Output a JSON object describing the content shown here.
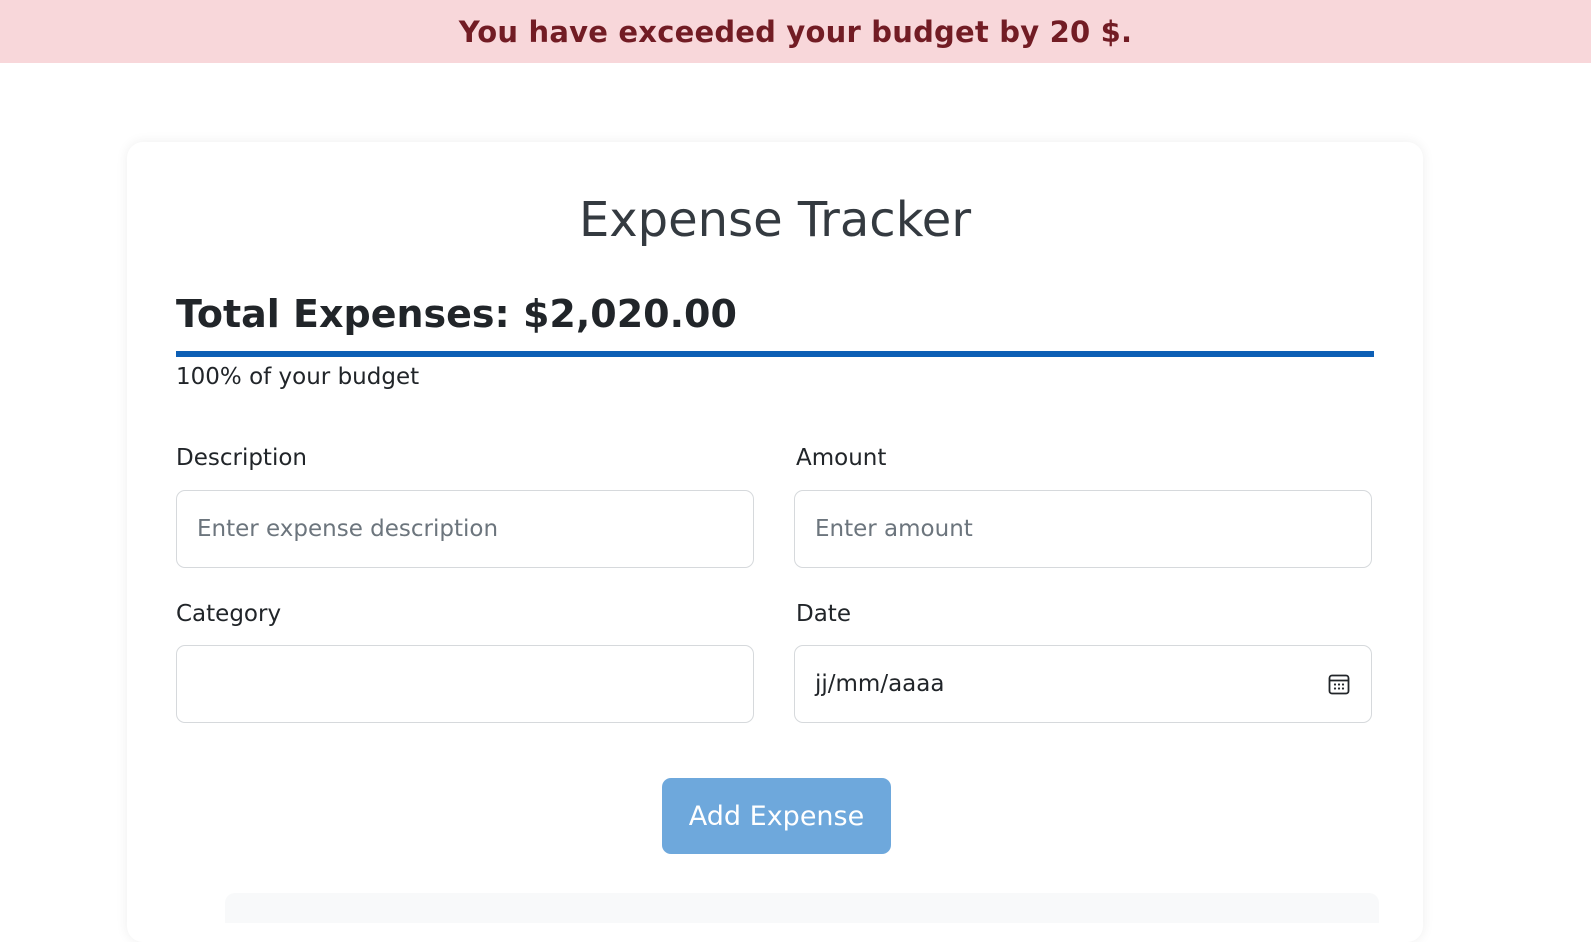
{
  "alert": {
    "message": "You have exceeded your budget by 20 $.",
    "background": "#f8d7da",
    "text_color": "#721c24"
  },
  "app": {
    "title": "Expense Tracker"
  },
  "summary": {
    "total_label": "Total Expenses: $2,020.00",
    "progress_percent": 100,
    "progress_color": "#0d5fb5",
    "budget_text": "100% of your budget"
  },
  "form": {
    "description": {
      "label": "Description",
      "placeholder": "Enter expense description",
      "value": ""
    },
    "amount": {
      "label": "Amount",
      "placeholder": "Enter amount",
      "value": ""
    },
    "category": {
      "label": "Category",
      "value": ""
    },
    "date": {
      "label": "Date",
      "value": "jj/mm/aaaa",
      "icon": "calendar-icon"
    },
    "submit_label": "Add Expense",
    "submit_color": "#6ea8dc"
  }
}
